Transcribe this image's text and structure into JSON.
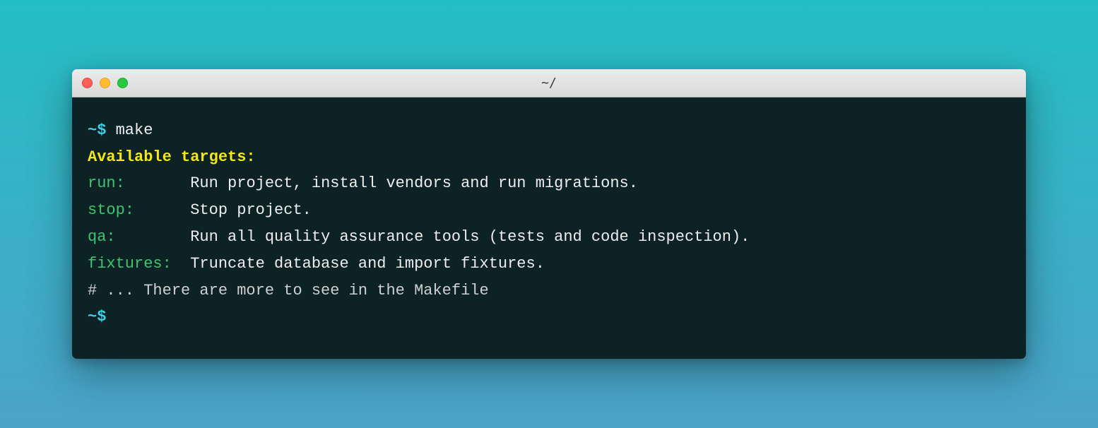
{
  "window": {
    "title": "~/"
  },
  "terminal": {
    "prompt": "~$",
    "command": "make",
    "header": "Available targets:",
    "targets": [
      {
        "name": "run:",
        "desc": "Run project, install vendors and run migrations."
      },
      {
        "name": "stop:",
        "desc": "Stop project."
      },
      {
        "name": "qa:",
        "desc": "Run all quality assurance tools (tests and code inspection)."
      },
      {
        "name": "fixtures:",
        "desc": "Truncate database and import fixtures."
      }
    ],
    "comment": "# ... There are more to see in the Makefile",
    "prompt2": "~$"
  }
}
